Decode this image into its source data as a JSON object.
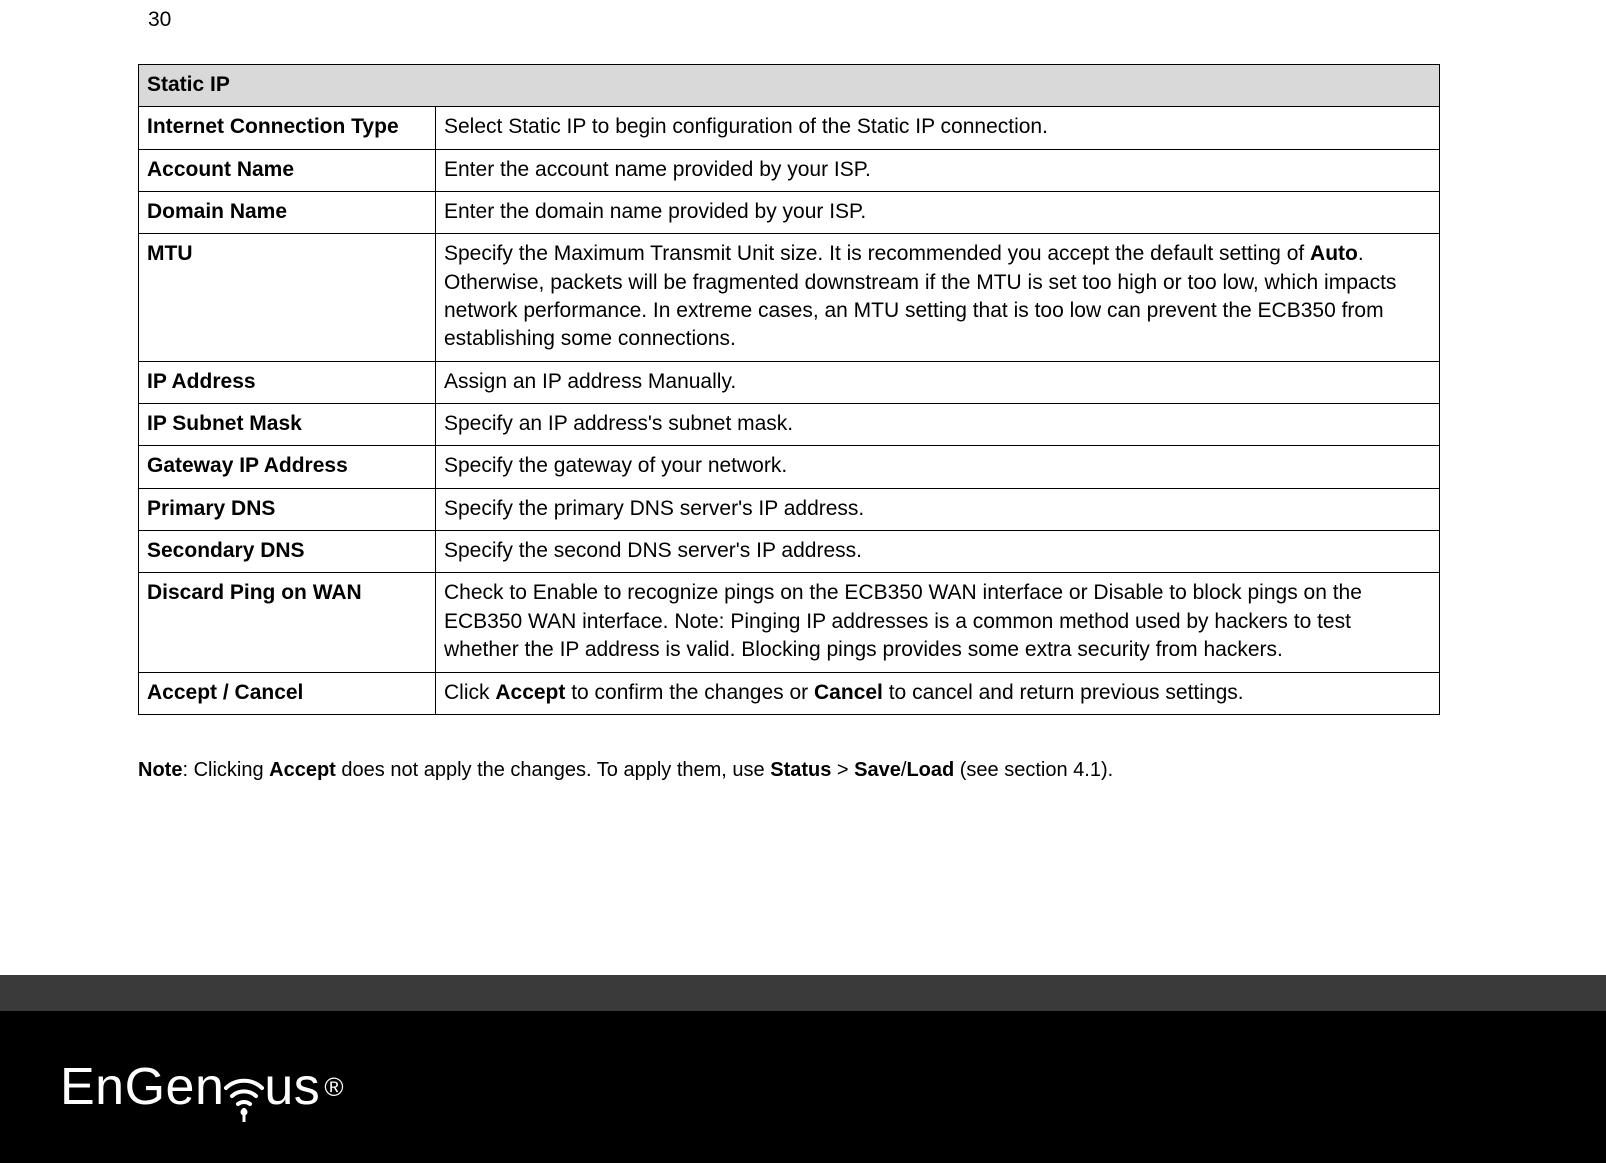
{
  "page_number": "30",
  "table": {
    "header": "Static IP",
    "rows": [
      {
        "label": "Internet Connection Type",
        "desc_html": "Select Static IP to begin configuration of the Static IP connection."
      },
      {
        "label": "Account Name",
        "desc_html": "Enter the account name provided by your ISP."
      },
      {
        "label": "Domain Name",
        "desc_html": "Enter the domain name provided by your ISP."
      },
      {
        "label": "MTU",
        "desc_html": "Specify the Maximum Transmit Unit size. It is recommended you accept the default setting of <b>Auto</b>. Otherwise, packets will be fragmented downstream if the MTU is set too high or too low, which impacts network performance. In extreme cases, an MTU setting that is too low can prevent the ECB350 from establishing some connections.",
        "justify": true
      },
      {
        "label": "IP Address",
        "desc_html": "Assign an IP address Manually."
      },
      {
        "label": "IP Subnet Mask",
        "desc_html": "Specify an IP address's subnet mask."
      },
      {
        "label": "Gateway IP Address",
        "desc_html": "Specify the gateway of your network."
      },
      {
        "label": "Primary DNS",
        "desc_html": "Specify the primary DNS server's IP address."
      },
      {
        "label": "Secondary DNS",
        "desc_html": "Specify the second DNS server's IP address."
      },
      {
        "label": "Discard Ping on WAN",
        "desc_html": "Check to Enable to recognize pings on the ECB350 WAN interface or Disable to block pings on the ECB350 WAN interface. Note: Pinging IP addresses is a common method used by hackers to test whether the IP address is valid. Blocking pings provides some extra security from hackers.",
        "justify": true
      },
      {
        "label": "Accept / Cancel",
        "desc_html": "Click <b>Accept</b> to confirm the changes or <b>Cancel</b> to cancel and return previous settings."
      }
    ]
  },
  "note_html": "<b>Note</b>: Clicking <b>Accept</b> does not apply the changes. To apply them, use <b>Status</b> > <b>Save</b>/<b>Load</b> (see section 4.1).",
  "brand": {
    "name": "EnGenius",
    "reg": "®"
  }
}
